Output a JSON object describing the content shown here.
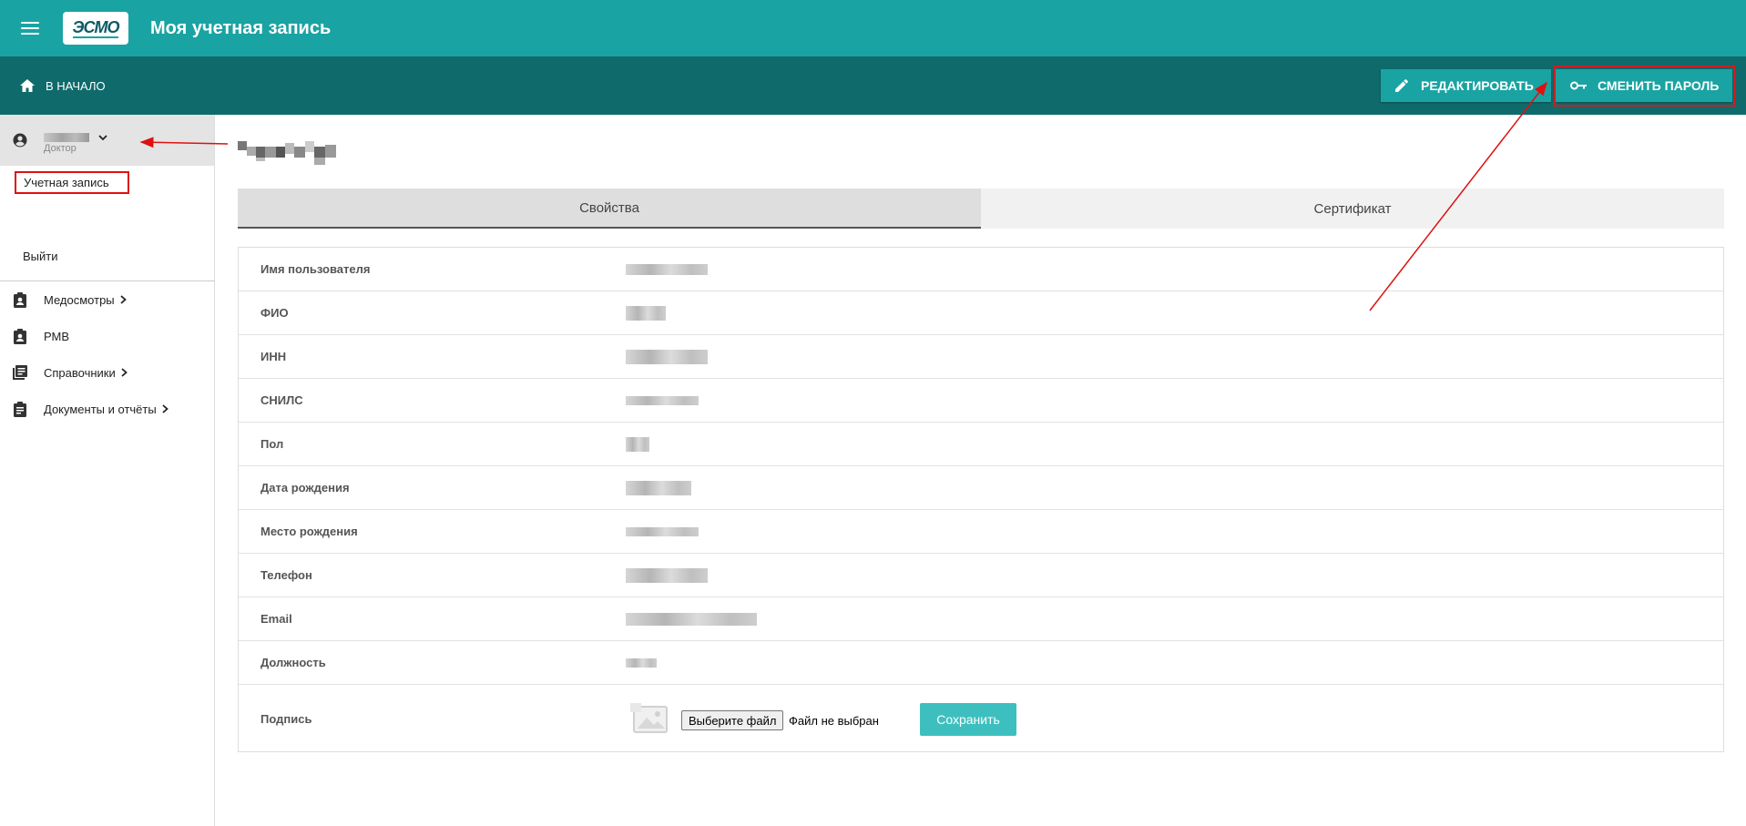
{
  "header": {
    "logo_text": "ЭСМО",
    "title": "Моя учетная запись",
    "brand_color": "#1aa3a3",
    "dark_color": "#0f6a6c"
  },
  "toolbar": {
    "home_label": "В НАЧАЛО",
    "edit_label": "РЕДАКТИРОВАТЬ",
    "change_password_label": "СМЕНИТЬ ПАРОЛЬ"
  },
  "sidebar": {
    "user_role": "Доктор",
    "account_link": "Учетная запись",
    "logout": "Выйти",
    "items": [
      {
        "label": "Медосмотры",
        "icon": "clipboard-account-icon",
        "has_children": true
      },
      {
        "label": "РМВ",
        "icon": "clipboard-account-icon",
        "has_children": false
      },
      {
        "label": "Справочники",
        "icon": "book-list-icon",
        "has_children": true
      },
      {
        "label": "Документы и отчёты",
        "icon": "clipboard-text-icon",
        "has_children": true
      }
    ]
  },
  "tabs": [
    {
      "label": "Свойства",
      "active": true
    },
    {
      "label": "Сертификат",
      "active": false
    }
  ],
  "properties": [
    {
      "label": "Имя пользователя"
    },
    {
      "label": "ФИО"
    },
    {
      "label": "ИНН"
    },
    {
      "label": "СНИЛС"
    },
    {
      "label": "Пол"
    },
    {
      "label": "Дата рождения"
    },
    {
      "label": "Место рождения"
    },
    {
      "label": "Телефон"
    },
    {
      "label": "Email"
    },
    {
      "label": "Должность"
    }
  ],
  "signature": {
    "label": "Подпись",
    "choose_file": "Выберите файл",
    "no_file": "Файл не выбран",
    "save": "Сохранить"
  }
}
